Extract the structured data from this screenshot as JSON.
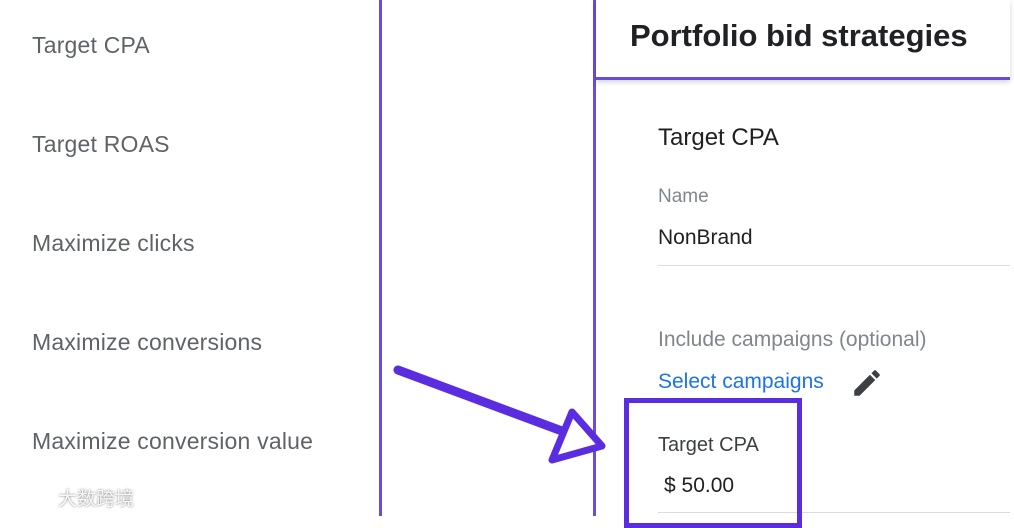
{
  "sidebar": {
    "items": [
      {
        "label": "Target CPA"
      },
      {
        "label": "Target ROAS"
      },
      {
        "label": "Maximize clicks"
      },
      {
        "label": "Maximize conversions"
      },
      {
        "label": "Maximize conversion value"
      }
    ]
  },
  "panel": {
    "title": "Portfolio bid strategies",
    "section_title": "Target CPA",
    "name_label": "Name",
    "name_value": "NonBrand",
    "include_label": "Include campaigns (optional)",
    "select_link": "Select campaigns",
    "target_label": "Target CPA",
    "target_value": "$ 50.00"
  },
  "watermark": {
    "text": "大数跨境"
  },
  "colors": {
    "annotation": "#5a2ee0",
    "link": "#1a73e8",
    "divider": "#6a4cd8"
  },
  "icons": {
    "edit": "pencil-icon",
    "annotation": "arrow-icon"
  }
}
